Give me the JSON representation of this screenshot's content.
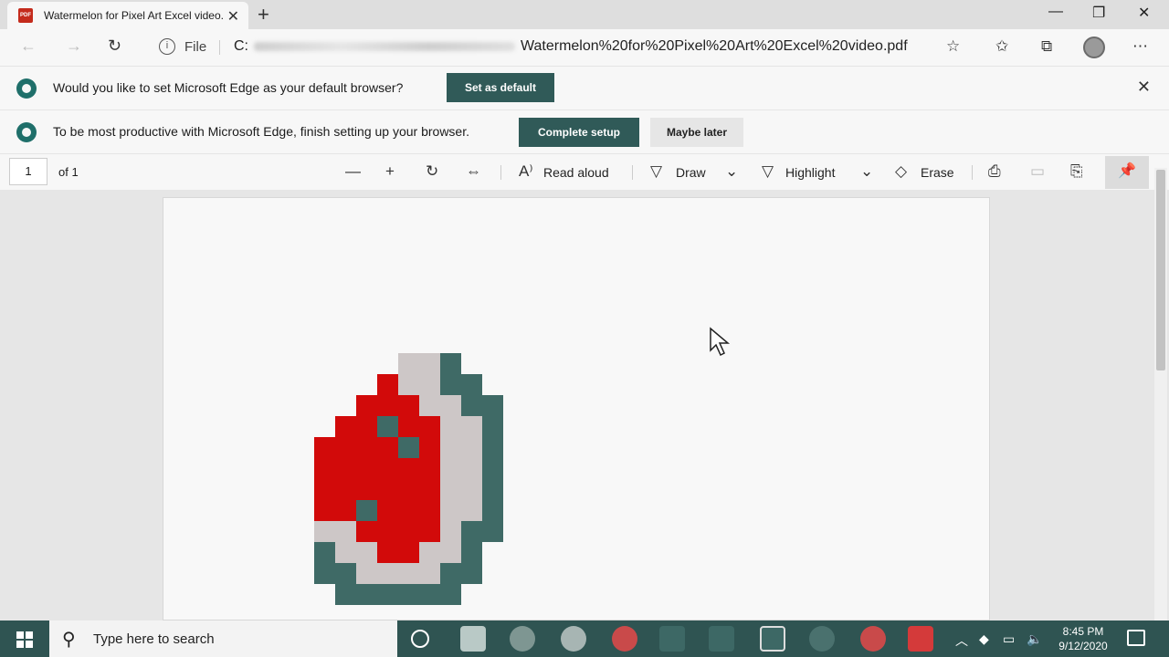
{
  "tab": {
    "title": "Watermelon for Pixel Art Excel video.pdf",
    "icon": "pdf-icon"
  },
  "window_controls": {
    "minimize": "—",
    "restore": "❐",
    "close": "✕"
  },
  "address_bar": {
    "scheme": "File",
    "drive": "C:",
    "url_tail": "Watermelon%20for%20Pixel%20Art%20Excel%20video.pdf"
  },
  "notification_default": {
    "message": "Would you like to set Microsoft Edge as your default browser?",
    "button": "Set as default"
  },
  "notification_setup": {
    "message": "To be most productive with Microsoft Edge, finish setting up your browser.",
    "primary_button": "Complete setup",
    "secondary_button": "Maybe later"
  },
  "pdf_toolbar": {
    "page_number": "1",
    "page_total": "of 1",
    "read_aloud": "Read aloud",
    "draw": "Draw",
    "highlight": "Highlight",
    "erase": "Erase"
  },
  "pixel_art": {
    "colors": {
      "red": "#d20a0a",
      "light": "#cdc7c7",
      "dark": "#3f6a66",
      "bg": "#f8f8f8"
    },
    "rows": [
      "....LLD...",
      "...RLLDD..",
      "..RRRLLDD.",
      ".RRDRRLLD.",
      "RRRRDRLLD.",
      "RRRRRRLLD.",
      "RRRRRRLLD.",
      "RRDRRRLLD.",
      "LLRRRRLDD.",
      "DLLRRLLD..",
      "DDLLLLDD..",
      ".DDDDDD..."
    ]
  },
  "taskbar": {
    "search_placeholder": "Type here to search",
    "time": "8:45 PM",
    "date": "9/12/2020",
    "colors": {
      "bar": "#2f5452"
    }
  }
}
